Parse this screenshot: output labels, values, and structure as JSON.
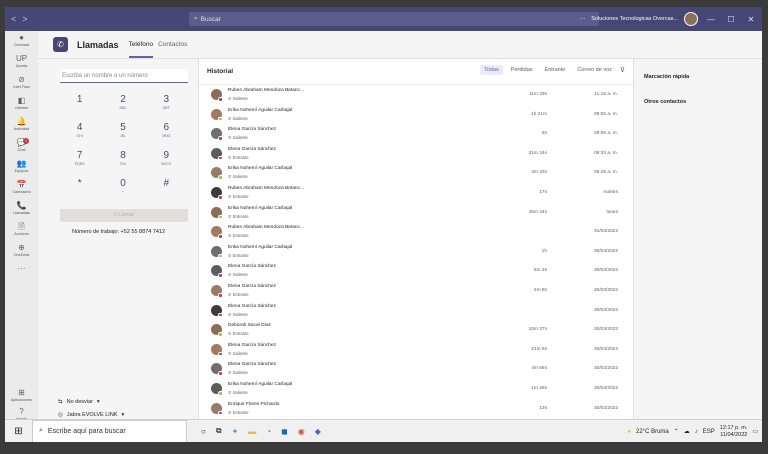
{
  "titlebar": {
    "search_placeholder": "Buscar",
    "more": "···",
    "org": "Soluciones Tecnologicas Overcas...",
    "minimize": "—",
    "maximize": "☐",
    "close": "✕"
  },
  "rail": {
    "items": [
      {
        "icon": "●",
        "label": "Overcast"
      },
      {
        "icon": "UP",
        "label": "Uporta"
      },
      {
        "icon": "⊘",
        "label": "Intel Flow"
      },
      {
        "icon": "◧",
        "label": "Yammer"
      },
      {
        "icon": "🔔",
        "label": "Actividad"
      },
      {
        "icon": "💬",
        "label": "Chat"
      },
      {
        "icon": "👥",
        "label": "Equipos"
      },
      {
        "icon": "📅",
        "label": "Calendario"
      },
      {
        "icon": "📞",
        "label": "Llamadas"
      },
      {
        "icon": "🗎",
        "label": "Archivos"
      },
      {
        "icon": "⊕",
        "label": "OneDesk"
      },
      {
        "icon": "···",
        "label": ""
      }
    ],
    "apps": {
      "icon": "⊞",
      "label": "Aplicaciones"
    },
    "help": {
      "icon": "?",
      "label": "Ayuda"
    },
    "chat_badge": "1"
  },
  "header": {
    "title": "Llamadas",
    "tab_phone": "Teléfono",
    "tab_contacts": "Contactos"
  },
  "dialpad": {
    "placeholder": "Escriba un nombre o un número",
    "keys": [
      {
        "d": "1",
        "l": ""
      },
      {
        "d": "2",
        "l": "ABC"
      },
      {
        "d": "3",
        "l": "DEF"
      },
      {
        "d": "4",
        "l": "GHI"
      },
      {
        "d": "5",
        "l": "JKL"
      },
      {
        "d": "6",
        "l": "MNO"
      },
      {
        "d": "7",
        "l": "PQRS"
      },
      {
        "d": "8",
        "l": "TUV"
      },
      {
        "d": "9",
        "l": "WXYZ"
      },
      {
        "d": "*",
        "l": ""
      },
      {
        "d": "0",
        "l": "+"
      },
      {
        "d": "#",
        "l": ""
      }
    ],
    "call_label": "Llamar",
    "work_number": "Número de trabajo: +52 55 8874 7412",
    "dnd": "No desviar",
    "device": "Jabra EVOLVE LINK"
  },
  "history": {
    "title": "Historial",
    "filters": [
      "Todas",
      "Perdidas",
      "Entrante",
      "Correo de voz"
    ],
    "rows": [
      {
        "name": "Ruben Abraham Mendoza Betanc...",
        "dir": "Saliente",
        "dur": "11m 33s",
        "date": "11:16 a. m.",
        "status": "red"
      },
      {
        "name": "Erika Nohemí Aguilar Carbajal",
        "dir": "Saliente",
        "dur": "1h 21m",
        "date": "09:55 a. m.",
        "status": "green"
      },
      {
        "name": "Elena García Sánchez",
        "dir": "Saliente",
        "dur": "8s",
        "date": "09:55 a. m.",
        "status": "red"
      },
      {
        "name": "Elena García Sánchez",
        "dir": "Entrante",
        "dur": "21m 34s",
        "date": "09:33 a. m.",
        "status": "red"
      },
      {
        "name": "Erika Nohemí Aguilar Carbajal",
        "dir": "Saliente",
        "dur": "3m 33s",
        "date": "09:26 a. m.",
        "status": "green"
      },
      {
        "name": "Ruben Abraham Mendoza Betanc...",
        "dir": "Entrante",
        "dur": "17s",
        "date": "martes",
        "status": "red"
      },
      {
        "name": "Erika Nohemí Aguilar Carbajal",
        "dir": "Entrante",
        "dur": "45m 44s",
        "date": "lunes",
        "status": "green"
      },
      {
        "name": "Ruben Abraham Mendoza Betanc...",
        "dir": "Entrante",
        "dur": "",
        "date": "31/03/2022",
        "status": "red"
      },
      {
        "name": "Erika Nohemí Aguilar Carbajal",
        "dir": "Entrante",
        "dur": "1h",
        "date": "30/03/2022",
        "status": "green"
      },
      {
        "name": "Elena García Sánchez",
        "dir": "Saliente",
        "dur": "6m 2s",
        "date": "30/03/2022",
        "status": "red"
      },
      {
        "name": "Elena García Sánchez",
        "dir": "Entrante",
        "dur": "2m 8s",
        "date": "30/03/2022",
        "status": "red"
      },
      {
        "name": "Elena García Sánchez",
        "dir": "Saliente",
        "dur": "",
        "date": "30/03/2022",
        "status": "red"
      },
      {
        "name": "Deborah Sacal Díaz",
        "dir": "Entrante",
        "dur": "10m 37s",
        "date": "30/03/2022",
        "status": "green"
      },
      {
        "name": "Elena García Sánchez",
        "dir": "Saliente",
        "dur": "21m 6s",
        "date": "30/03/2022",
        "status": "red"
      },
      {
        "name": "Elena García Sánchez",
        "dir": "Saliente",
        "dur": "4m 56s",
        "date": "30/03/2022",
        "status": "red"
      },
      {
        "name": "Erika Nohemí Aguilar Carbajal",
        "dir": "Saliente",
        "dur": "1m 26s",
        "date": "30/03/2022",
        "status": "green"
      },
      {
        "name": "Enrique Flores Pichardo",
        "dir": "Entrante",
        "dur": "13s",
        "date": "30/03/2022",
        "status": "red"
      }
    ]
  },
  "speed_dial": {
    "title": "Marcación rápida",
    "others": "Otros contactos"
  },
  "taskbar": {
    "search": "Escribe aquí para buscar",
    "weather": "22°C Bruma",
    "lang": "ESP",
    "time": "12:17 p. m.",
    "date": "11/04/2022"
  }
}
